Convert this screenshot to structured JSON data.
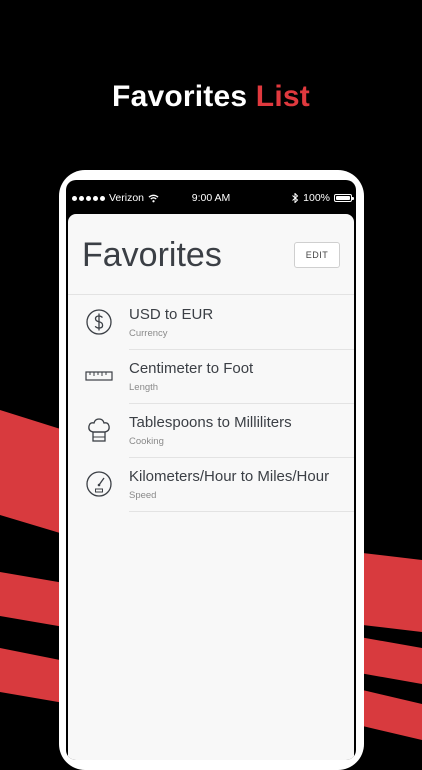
{
  "headline": {
    "part1": "Favorites",
    "part2": "List",
    "accent_color": "#e0393e"
  },
  "status_bar": {
    "carrier": "Verizon",
    "time": "9:00 AM",
    "battery": "100%"
  },
  "screen": {
    "title": "Favorites",
    "edit_label": "EDIT",
    "favorites": [
      {
        "title": "USD to EUR",
        "category": "Currency",
        "icon": "dollar-icon"
      },
      {
        "title": "Centimeter to Foot",
        "category": "Length",
        "icon": "ruler-icon"
      },
      {
        "title": "Tablespoons to Milliliters",
        "category": "Cooking",
        "icon": "chef-hat-icon"
      },
      {
        "title": "Kilometers/Hour to Miles/Hour",
        "category": "Speed",
        "icon": "speedometer-icon"
      }
    ]
  }
}
